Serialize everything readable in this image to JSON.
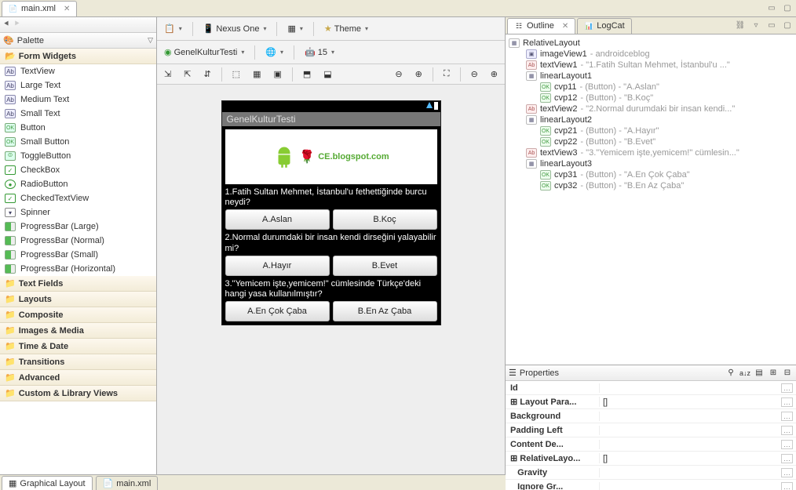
{
  "editorTab": {
    "label": "main.xml"
  },
  "paletteTitle": "Palette",
  "paletteTop": "Form Widgets",
  "widgets": [
    "TextView",
    "Large Text",
    "Medium Text",
    "Small Text",
    "Button",
    "Small Button",
    "ToggleButton",
    "CheckBox",
    "RadioButton",
    "CheckedTextView",
    "Spinner",
    "ProgressBar (Large)",
    "ProgressBar (Normal)",
    "ProgressBar (Small)",
    "ProgressBar (Horizontal)"
  ],
  "paletteCats": [
    "Text Fields",
    "Layouts",
    "Composite",
    "Images & Media",
    "Time & Date",
    "Transitions",
    "Advanced",
    "Custom & Library Views"
  ],
  "bottomTabs": {
    "graphical": "Graphical Layout",
    "xml": "main.xml"
  },
  "toolbar": {
    "device": "Nexus One",
    "theme": "Theme",
    "activity": "GenelKulturTesti",
    "api": "15"
  },
  "appTitle": "GenelKulturTesti",
  "logoText": "CE.blogspot.com",
  "questions": [
    {
      "q": "1.Fatih Sultan Mehmet, İstanbul'u fethettiğinde burcu neydi?",
      "a": "A.Aslan",
      "b": "B.Koç"
    },
    {
      "q": "2.Normal durumdaki bir insan kendi dirseğini yalayabilir mi?",
      "a": "A.Hayır",
      "b": "B.Evet"
    },
    {
      "q": "3.\"Yemicem işte,yemicem!\" cümlesinde Türkçe'deki hangi yasa kullanılmıştır?",
      "a": "A.En Çok Çaba",
      "b": "B.En Az Çaba"
    }
  ],
  "outlineTabs": {
    "outline": "Outline",
    "logcat": "LogCat"
  },
  "outline": {
    "root": "RelativeLayout",
    "items": [
      {
        "kind": "img",
        "name": "imageView1",
        "extra": "androidceblog",
        "indent": 1
      },
      {
        "kind": "txt",
        "name": "textView1",
        "extra": "\"1.Fatih Sultan Mehmet, İstanbul'u ...\"",
        "indent": 1
      },
      {
        "kind": "lay",
        "name": "linearLayout1",
        "extra": "",
        "indent": 1
      },
      {
        "kind": "btn",
        "name": "cvp11",
        "extra": "(Button) - \"A.Aslan\"",
        "indent": 2
      },
      {
        "kind": "btn",
        "name": "cvp12",
        "extra": "(Button) - \"B.Koç\"",
        "indent": 2
      },
      {
        "kind": "txt",
        "name": "textView2",
        "extra": "\"2.Normal durumdaki bir insan kendi...\"",
        "indent": 1
      },
      {
        "kind": "lay",
        "name": "linearLayout2",
        "extra": "",
        "indent": 1
      },
      {
        "kind": "btn",
        "name": "cvp21",
        "extra": "(Button) - \"A.Hayır\"",
        "indent": 2
      },
      {
        "kind": "btn",
        "name": "cvp22",
        "extra": "(Button) - \"B.Evet\"",
        "indent": 2
      },
      {
        "kind": "txt",
        "name": "textView3",
        "extra": "\"3.\"Yemicem işte,yemicem!\" cümlesin...\"",
        "indent": 1
      },
      {
        "kind": "lay",
        "name": "linearLayout3",
        "extra": "",
        "indent": 1
      },
      {
        "kind": "btn",
        "name": "cvp31",
        "extra": "(Button) - \"A.En Çok Çaba\"",
        "indent": 2
      },
      {
        "kind": "btn",
        "name": "cvp32",
        "extra": "(Button) - \"B.En Az Çaba\"",
        "indent": 2
      }
    ]
  },
  "propsTitle": "Properties",
  "properties": [
    {
      "k": "Id",
      "v": ""
    },
    {
      "k": "Layout Para...",
      "v": "[]"
    },
    {
      "k": "Background",
      "v": ""
    },
    {
      "k": "Padding Left",
      "v": ""
    },
    {
      "k": "Content De...",
      "v": ""
    },
    {
      "k": "RelativeLayo...",
      "v": "[]"
    },
    {
      "k": "Gravity",
      "v": ""
    },
    {
      "k": "Ignore Gr...",
      "v": ""
    }
  ]
}
